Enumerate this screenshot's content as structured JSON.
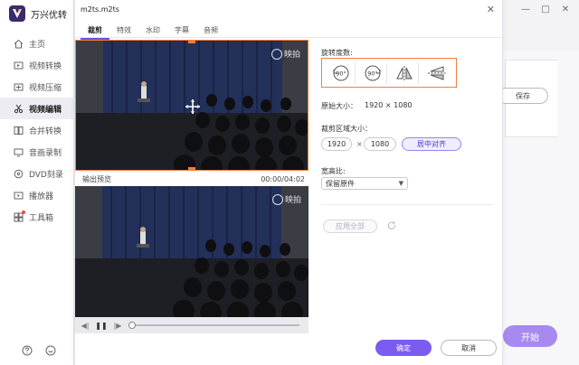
{
  "app": {
    "name": "万兴优转"
  },
  "sidebar": {
    "items": [
      {
        "label": "主页",
        "icon": "home-icon"
      },
      {
        "label": "视频转换",
        "icon": "convert-icon"
      },
      {
        "label": "视频压缩",
        "icon": "compress-icon"
      },
      {
        "label": "视频编辑",
        "icon": "scissors-icon",
        "active": true
      },
      {
        "label": "合并转换",
        "icon": "merge-icon"
      },
      {
        "label": "音画录制",
        "icon": "record-icon"
      },
      {
        "label": "DVD刻录",
        "icon": "dvd-icon"
      },
      {
        "label": "播放器",
        "icon": "player-icon"
      },
      {
        "label": "工具箱",
        "icon": "toolbox-icon"
      }
    ]
  },
  "background": {
    "save_label": "保存",
    "start_label": "开始"
  },
  "dialog": {
    "title": "m2ts.m2ts",
    "tabs": [
      "裁剪",
      "特效",
      "水印",
      "字幕",
      "音频"
    ],
    "watermark_text": "映拍",
    "preview_label": "输出预览",
    "time": "00:00/04:02",
    "rotation_label": "旋转度数:",
    "rotation_buttons": [
      {
        "name": "rotate-ccw-90",
        "text": "90°"
      },
      {
        "name": "rotate-cw-90",
        "text": "90°"
      },
      {
        "name": "flip-horizontal",
        "text": ""
      },
      {
        "name": "flip-vertical",
        "text": ""
      }
    ],
    "original_size_label": "原始大小：",
    "original_size_value": "1920 × 1080",
    "crop_area_label": "裁剪区域大小：",
    "crop_width": "1920",
    "crop_height": "1080",
    "crop_times": "×",
    "center_label": "居中对齐",
    "aspect_label": "宽高比:",
    "aspect_value": "保留原件",
    "apply_all_label": "应用全部",
    "ok_label": "确定",
    "cancel_label": "取消"
  },
  "colors": {
    "accent": "#7a5cf0",
    "highlight": "#f0803c"
  }
}
